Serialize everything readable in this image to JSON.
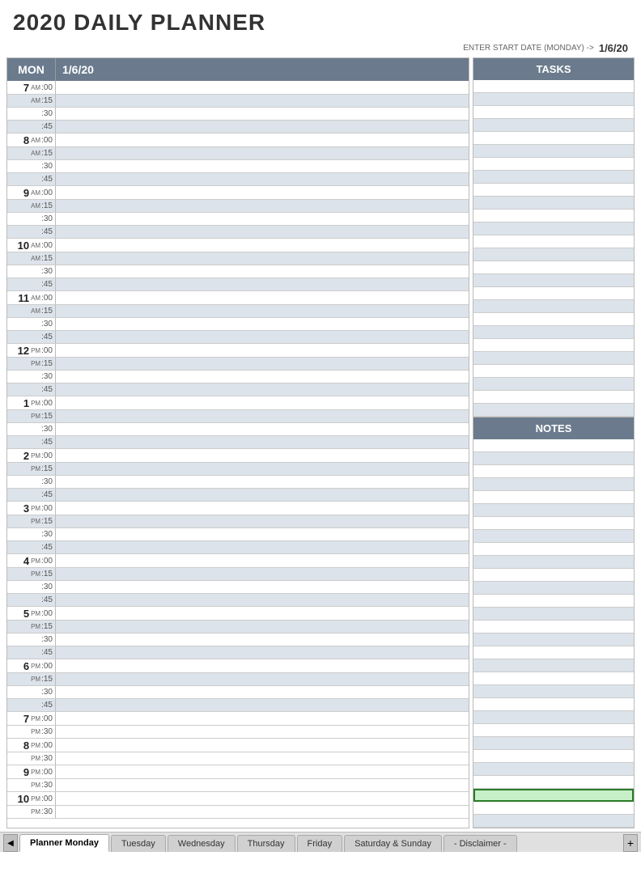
{
  "title": "2020 DAILY PLANNER",
  "date_prompt": "ENTER START DATE (MONDAY) ->",
  "start_date": "1/6/20",
  "schedule": {
    "day": "MON",
    "date": "1/6/20",
    "time_slots": [
      {
        "hour": "7",
        "ampm": "AM",
        "minutes": [
          ":00",
          ":15",
          ":30",
          ":45"
        ]
      },
      {
        "hour": "8",
        "ampm": "AM",
        "minutes": [
          ":00",
          ":15",
          ":30",
          ":45"
        ]
      },
      {
        "hour": "9",
        "ampm": "AM",
        "minutes": [
          ":00",
          ":15",
          ":30",
          ":45"
        ]
      },
      {
        "hour": "10",
        "ampm": "AM",
        "minutes": [
          ":00",
          ":15",
          ":30",
          ":45"
        ]
      },
      {
        "hour": "11",
        "ampm": "AM",
        "minutes": [
          ":00",
          ":15",
          ":30",
          ":45"
        ]
      },
      {
        "hour": "12",
        "ampm": "PM",
        "minutes": [
          ":00",
          ":15",
          ":30",
          ":45"
        ]
      },
      {
        "hour": "1",
        "ampm": "PM",
        "minutes": [
          ":00",
          ":15",
          ":30",
          ":45"
        ]
      },
      {
        "hour": "2",
        "ampm": "PM",
        "minutes": [
          ":00",
          ":15",
          ":30",
          ":45"
        ]
      },
      {
        "hour": "3",
        "ampm": "PM",
        "minutes": [
          ":00",
          ":15",
          ":30",
          ":45"
        ]
      },
      {
        "hour": "4",
        "ampm": "PM",
        "minutes": [
          ":00",
          ":15",
          ":30",
          ":45"
        ]
      },
      {
        "hour": "5",
        "ampm": "PM",
        "minutes": [
          ":00",
          ":15",
          ":30",
          ":45"
        ]
      },
      {
        "hour": "6",
        "ampm": "PM",
        "minutes": [
          ":00",
          ":15",
          ":30",
          ":45"
        ]
      },
      {
        "hour": "7",
        "ampm": "PM",
        "minutes": [
          ":00",
          ":30"
        ]
      },
      {
        "hour": "8",
        "ampm": "PM",
        "minutes": [
          ":00",
          ":30"
        ]
      },
      {
        "hour": "9",
        "ampm": "PM",
        "minutes": [
          ":00",
          ":30"
        ]
      },
      {
        "hour": "10",
        "ampm": "PM",
        "minutes": [
          ":00",
          ":30"
        ]
      }
    ]
  },
  "sidebar": {
    "tasks_label": "TASKS",
    "notes_label": "NOTES",
    "task_rows": 30,
    "note_rows": 30
  },
  "tabs": [
    {
      "label": "Planner Monday",
      "active": true
    },
    {
      "label": "Tuesday",
      "active": false
    },
    {
      "label": "Wednesday",
      "active": false
    },
    {
      "label": "Thursday",
      "active": false
    },
    {
      "label": "Friday",
      "active": false
    },
    {
      "label": "Saturday & Sunday",
      "active": false
    },
    {
      "label": "- Disclaimer -",
      "active": false
    }
  ],
  "tab_nav_prev": "◀",
  "tab_add": "+"
}
